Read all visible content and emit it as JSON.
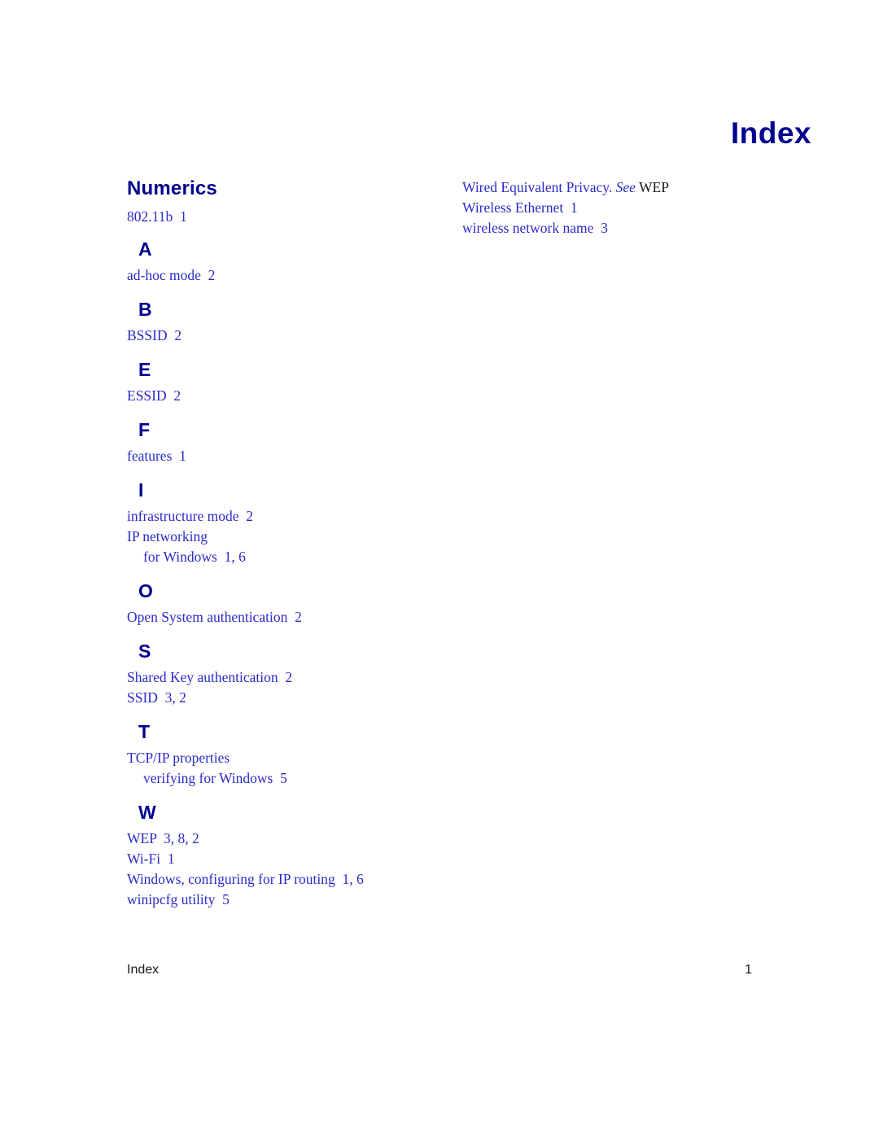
{
  "document": {
    "title": "Index",
    "footer": {
      "label": "Index",
      "page_number": "1"
    }
  },
  "left_column": {
    "groups": [
      {
        "heading": "Numerics",
        "heading_style": "numerics",
        "entries": [
          {
            "text": "802.11b  1",
            "sub": false
          }
        ]
      },
      {
        "heading": "A",
        "heading_style": "letter",
        "entries": [
          {
            "text": "ad-hoc mode  2",
            "sub": false
          }
        ]
      },
      {
        "heading": "B",
        "heading_style": "letter",
        "entries": [
          {
            "text": "BSSID  2",
            "sub": false
          }
        ]
      },
      {
        "heading": "E",
        "heading_style": "letter",
        "entries": [
          {
            "text": "ESSID  2",
            "sub": false
          }
        ]
      },
      {
        "heading": "F",
        "heading_style": "letter",
        "entries": [
          {
            "text": "features  1",
            "sub": false
          }
        ]
      },
      {
        "heading": "I",
        "heading_style": "letter",
        "entries": [
          {
            "text": "infrastructure mode  2",
            "sub": false
          },
          {
            "text": "IP networking",
            "sub": false
          },
          {
            "text": "for Windows  1, 6",
            "sub": true
          }
        ]
      },
      {
        "heading": "O",
        "heading_style": "letter",
        "entries": [
          {
            "text": "Open System authentication  2",
            "sub": false
          }
        ]
      },
      {
        "heading": "S",
        "heading_style": "letter",
        "entries": [
          {
            "text": "Shared Key authentication  2",
            "sub": false
          },
          {
            "text": "SSID  3, 2",
            "sub": false
          }
        ]
      },
      {
        "heading": "T",
        "heading_style": "letter",
        "entries": [
          {
            "text": "TCP/IP properties",
            "sub": false
          },
          {
            "text": "verifying for Windows  5",
            "sub": true
          }
        ]
      },
      {
        "heading": "W",
        "heading_style": "letter",
        "entries": [
          {
            "text": "WEP  3, 8, 2",
            "sub": false
          },
          {
            "text": "Wi-Fi  1",
            "sub": false
          },
          {
            "text": "Windows, configuring for IP routing  1, 6",
            "sub": false
          },
          {
            "text": "winipcfg utility  5",
            "sub": false
          }
        ]
      }
    ]
  },
  "right_column": {
    "entries": [
      {
        "parts": [
          {
            "text": "Wired Equivalent Privacy. ",
            "style": "normal"
          },
          {
            "text": "See",
            "style": "italic"
          },
          {
            "text": " WEP",
            "style": "black"
          }
        ]
      },
      {
        "parts": [
          {
            "text": "Wireless Ethernet  1",
            "style": "normal"
          }
        ]
      },
      {
        "parts": [
          {
            "text": "wireless network name  3",
            "style": "normal"
          }
        ]
      }
    ]
  }
}
